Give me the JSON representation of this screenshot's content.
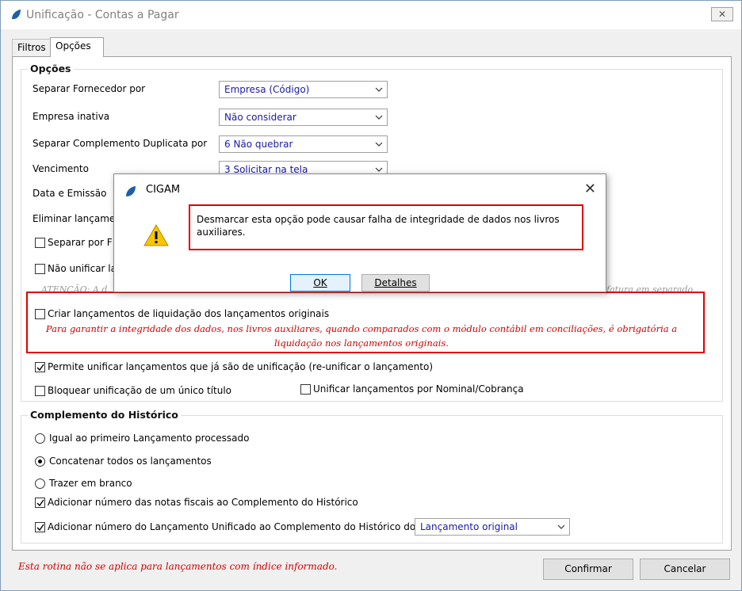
{
  "window": {
    "title": "Unificação - Contas a Pagar",
    "close_glyph": "✕"
  },
  "tabs": [
    {
      "label": "Filtros"
    },
    {
      "label": "Opções"
    }
  ],
  "options": {
    "group_title": "Opções",
    "rows": [
      {
        "label": "Separar Fornecedor por",
        "value": "Empresa (Código)"
      },
      {
        "label": "Empresa inativa",
        "value": "Não considerar"
      },
      {
        "label": "Separar Complemento Duplicata por",
        "value": "6 Não quebrar"
      },
      {
        "label": "Vencimento",
        "value": "3 Solicitar na tela"
      },
      {
        "label": "Data e Emissão"
      },
      {
        "label": "Eliminar lançame"
      }
    ],
    "cb_separar": "Separar por F",
    "cb_nao_unificar": "Não unificar la",
    "atencao_left": "ATENÇÃO: A d",
    "atencao_right": "fatura em separado",
    "cb_criar": "Criar lançamentos de liquidação dos lançamentos originais",
    "warn_line1": "Para garantir a integridade dos dados, nos livros auxiliares, quando comparados com o módulo contábil em conciliações, é obrigatória a",
    "warn_line2": "liquidação nos lançamentos originais.",
    "cb_permite": "Permite unificar lançamentos que já são de unificação (re-unificar o lançamento)",
    "cb_bloquear": "Bloquear unificação de um único título",
    "cb_nominal": "Unificar lançamentos por Nominal/Cobrança"
  },
  "historico": {
    "group_title": "Complemento do Histórico",
    "radio_igual": "Igual ao primeiro Lançamento processado",
    "radio_concatenar": "Concatenar todos os lançamentos",
    "radio_branco": "Trazer em branco",
    "cb_notas": "Adicionar número das notas fiscais ao Complemento do Histórico",
    "cb_lancamento": "Adicionar número do Lançamento Unificado ao Complemento do Histórico do",
    "combo_value": "Lançamento original"
  },
  "footer": {
    "note": "Esta rotina não se aplica para lançamentos com índice informado.",
    "confirm": "Confirmar",
    "cancel": "Cancelar"
  },
  "dialog": {
    "title": "CIGAM",
    "close_glyph": "✕",
    "message": "Desmarcar esta opção pode causar falha de integridade de dados nos livros auxiliares.",
    "ok": "OK",
    "details": "Detalhes"
  },
  "colors": {
    "red": "#e00000",
    "value_blue": "#1a1aa6",
    "logo_blue": "#1f5fa8"
  }
}
